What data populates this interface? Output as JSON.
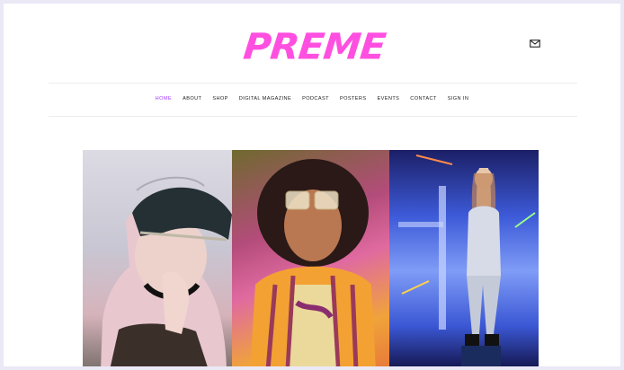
{
  "brand": {
    "logo_text": "PREME",
    "accent": "#ff4fe0",
    "nav_active_color": "#a23cff"
  },
  "header": {
    "mail_icon": "mail-icon"
  },
  "nav": {
    "items": [
      {
        "label": "HOME",
        "active": true
      },
      {
        "label": "ABOUT"
      },
      {
        "label": "SHOP"
      },
      {
        "label": "DIGITAL MAGAZINE"
      },
      {
        "label": "PODCAST"
      },
      {
        "label": "POSTERS"
      },
      {
        "label": "EVENTS"
      },
      {
        "label": "CONTACT"
      },
      {
        "label": "SIGN IN"
      }
    ]
  },
  "gallery": {
    "photos": [
      {
        "name": "portrait-captain-hat"
      },
      {
        "name": "portrait-sunglasses-jacket"
      },
      {
        "name": "portrait-silver-outfit"
      }
    ]
  }
}
